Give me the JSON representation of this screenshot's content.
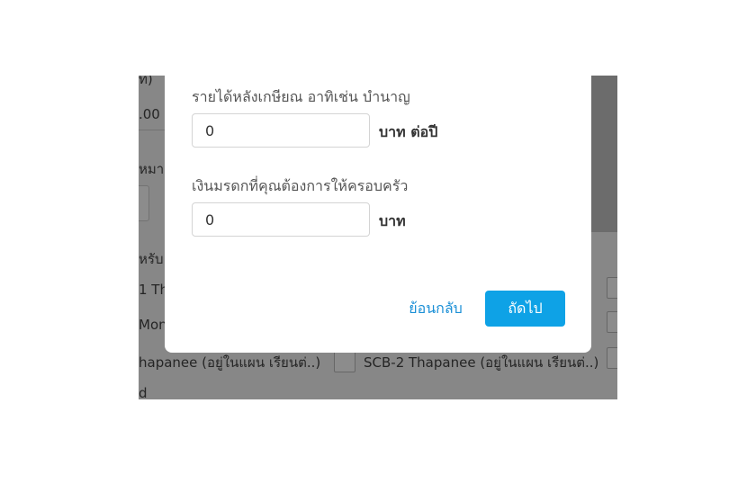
{
  "background": {
    "texts": {
      "t1": "ท)",
      "t2": ".00",
      "t3": "หมา",
      "t4": "หรับ",
      "t5": "1 Th",
      "t6": "Mon",
      "t7": "hapanee (อยู่ในแผน เรียนต่..)",
      "t8": "SCB-2 Thapanee (อยู่ในแผน เรียนต่..)",
      "t9": "d"
    }
  },
  "modal": {
    "income": {
      "label": "รายได้หลังเกษียณ อาทิเช่น บำนาญ",
      "value": "0",
      "unit": "บาท ต่อปี"
    },
    "inheritance": {
      "label": "เงินมรดกที่คุณต้องการให้ครอบครัว",
      "value": "0",
      "unit": "บาท"
    },
    "back_label": "ย้อนกลับ",
    "next_label": "ถัดไป"
  },
  "colors": {
    "accent": "#0ea2e6",
    "link": "#1a8fd6"
  }
}
